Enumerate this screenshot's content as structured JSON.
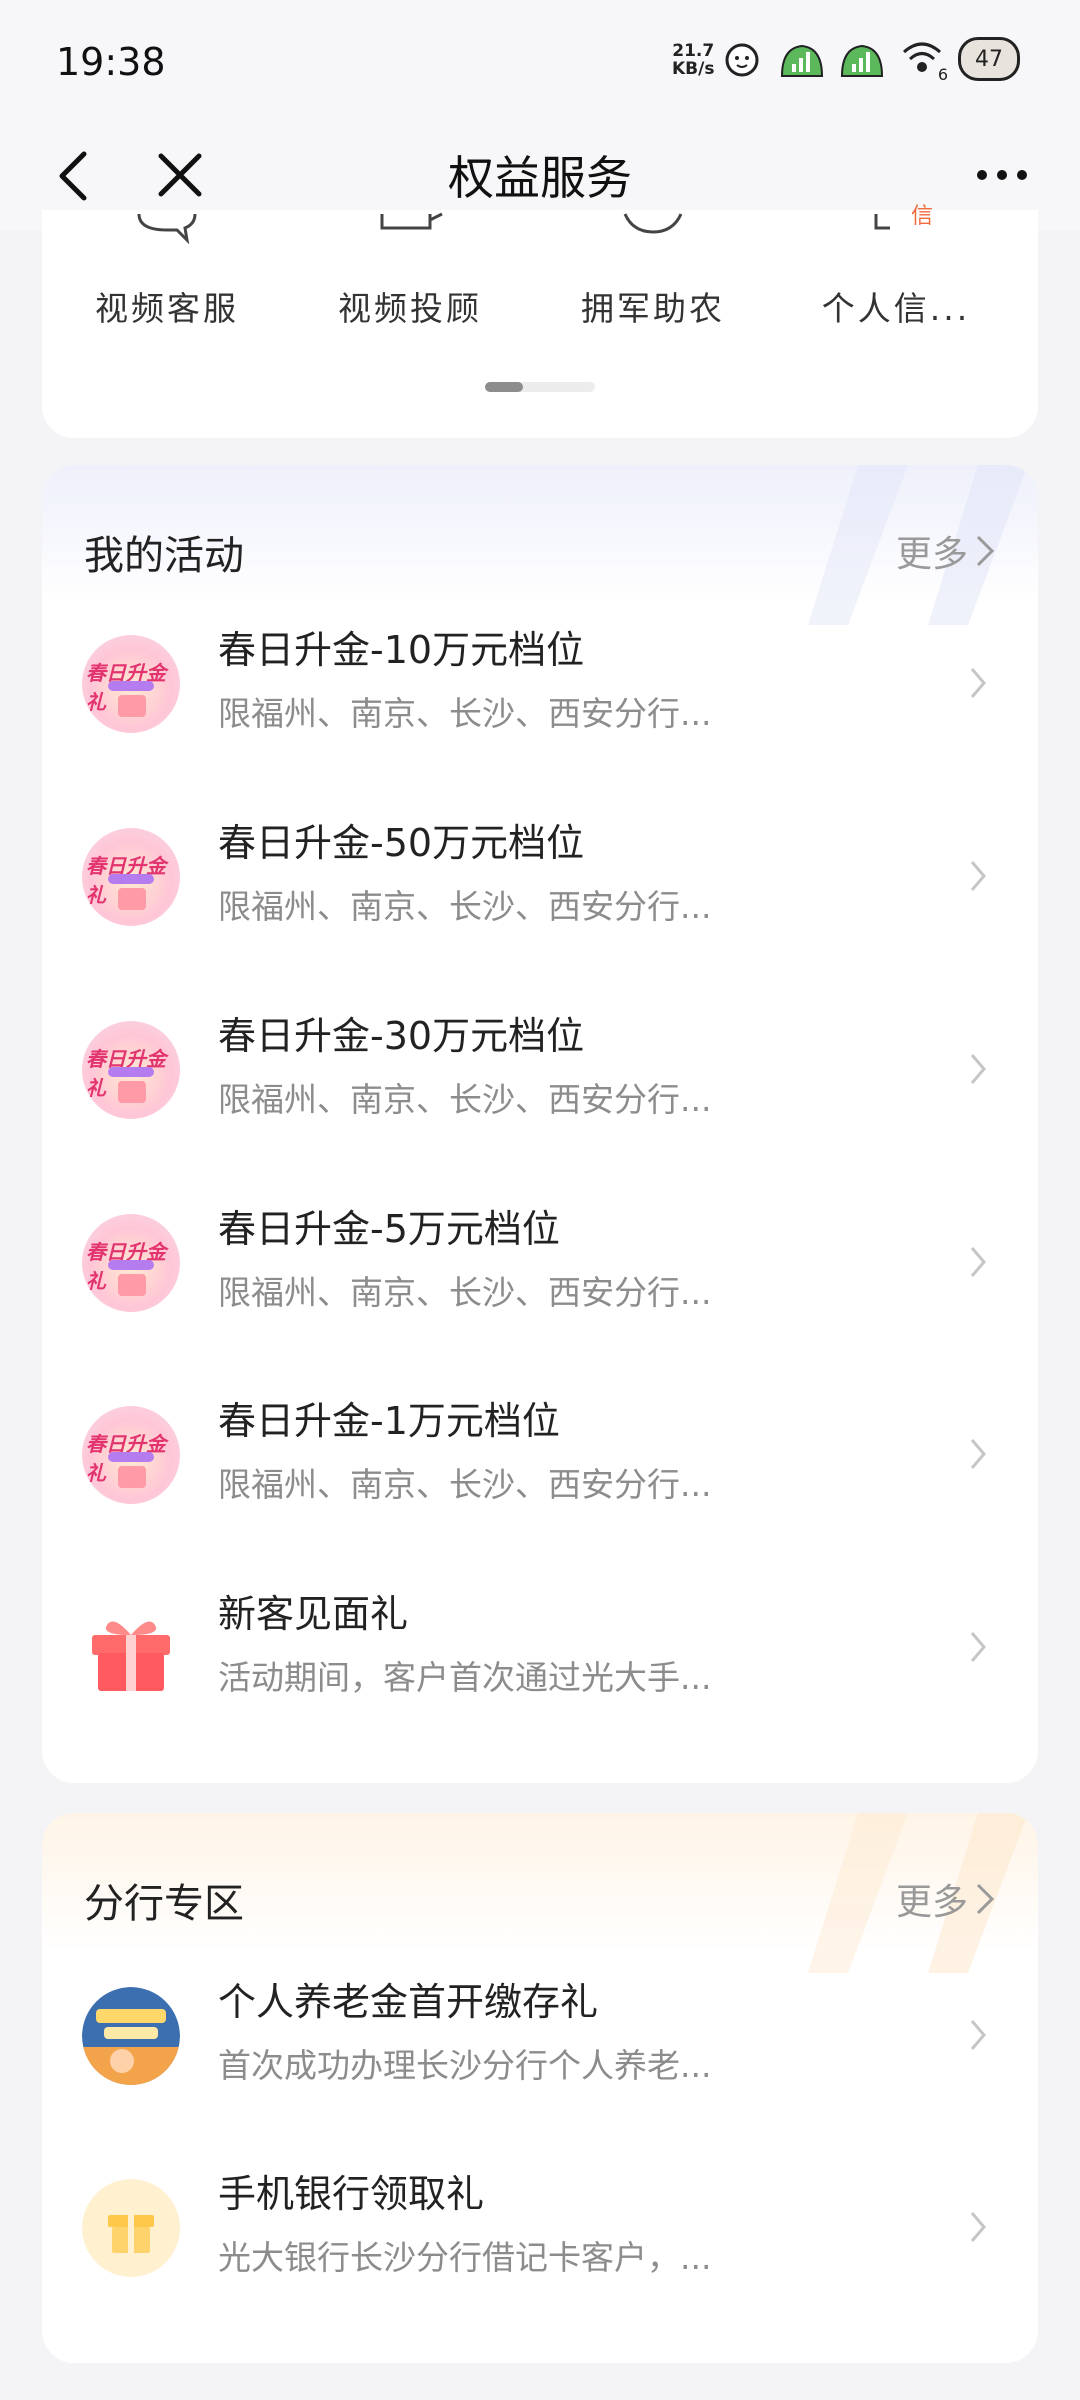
{
  "status_bar": {
    "time": "19:38",
    "net_speed_value": "21.7",
    "net_speed_unit": "KB/s",
    "wifi_badge": "6",
    "battery": "47"
  },
  "nav": {
    "title": "权益服务"
  },
  "quick_services": [
    {
      "label": "视频客服",
      "icon": "chat-bubble-icon"
    },
    {
      "label": "视频投顾",
      "icon": "video-advisor-icon"
    },
    {
      "label": "拥军助农",
      "icon": "shield-heart-icon"
    },
    {
      "label": "个人信...",
      "icon": "personal-info-icon",
      "icon_text": "信"
    }
  ],
  "my_activities": {
    "heading": "我的活动",
    "more": "更多",
    "items": [
      {
        "title": "春日升金-10万元档位",
        "desc": "限福州、南京、长沙、西安分行...",
        "thumb_text": "春日升金礼"
      },
      {
        "title": "春日升金-50万元档位",
        "desc": "限福州、南京、长沙、西安分行...",
        "thumb_text": "春日升金礼"
      },
      {
        "title": "春日升金-30万元档位",
        "desc": "限福州、南京、长沙、西安分行...",
        "thumb_text": "春日升金礼"
      },
      {
        "title": "春日升金-5万元档位",
        "desc": "限福州、南京、长沙、西安分行...",
        "thumb_text": "春日升金礼"
      },
      {
        "title": "春日升金-1万元档位",
        "desc": "限福州、南京、长沙、西安分行...",
        "thumb_text": "春日升金礼"
      },
      {
        "title": "新客见面礼",
        "desc": "活动期间，客户首次通过光大手..."
      }
    ]
  },
  "branch_zone": {
    "heading": "分行专区",
    "more": "更多",
    "items": [
      {
        "title": "个人养老金首开缴存礼",
        "desc": "首次成功办理长沙分行个人养老..."
      },
      {
        "title": "手机银行领取礼",
        "desc": "光大银行长沙分行借记卡客户，..."
      }
    ]
  },
  "colors": {
    "accent_pink": "#e2346f",
    "gift_red": "#ff5a5f",
    "gift_yellow": "#ffd36b"
  }
}
